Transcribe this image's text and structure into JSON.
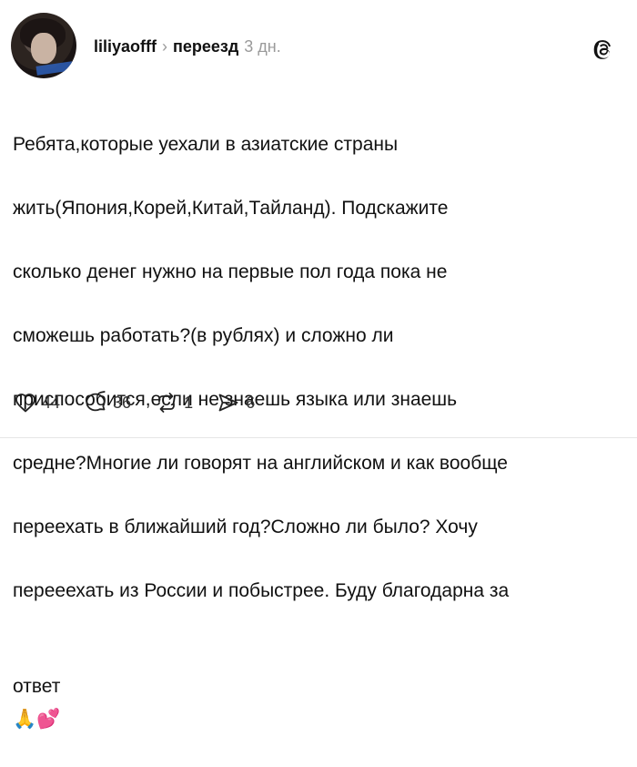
{
  "post": {
    "username": "liliyaofff",
    "chevron": "›",
    "topic": "переезд",
    "time": "3 дн.",
    "text_lines": [
      "Ребята,которые уехали в азиатские страны",
      "жить(Япония,Корей,Китай,Тайланд). Подскажите",
      "сколько денег нужно на первые пол года пока не",
      "сможешь работать?(в рублях) и сложно ли",
      "приспособится,если не знаешь языка или знаешь",
      "средне?Многие ли говорят на английском и как вообще",
      "переехать в ближайший год?Сложно ли было? Хочу",
      "перееехать из России и побыстрее. Буду благодарна за",
      "ответ"
    ],
    "emojis": [
      "🙏",
      "💕"
    ],
    "actions": {
      "likes": "44",
      "comments": "36",
      "reposts": "1",
      "shares": "6"
    }
  },
  "icons": {
    "app": "threads-logo-icon",
    "like": "heart-icon",
    "comment": "comment-bubble-icon",
    "repost": "repost-icon",
    "share": "send-icon"
  }
}
